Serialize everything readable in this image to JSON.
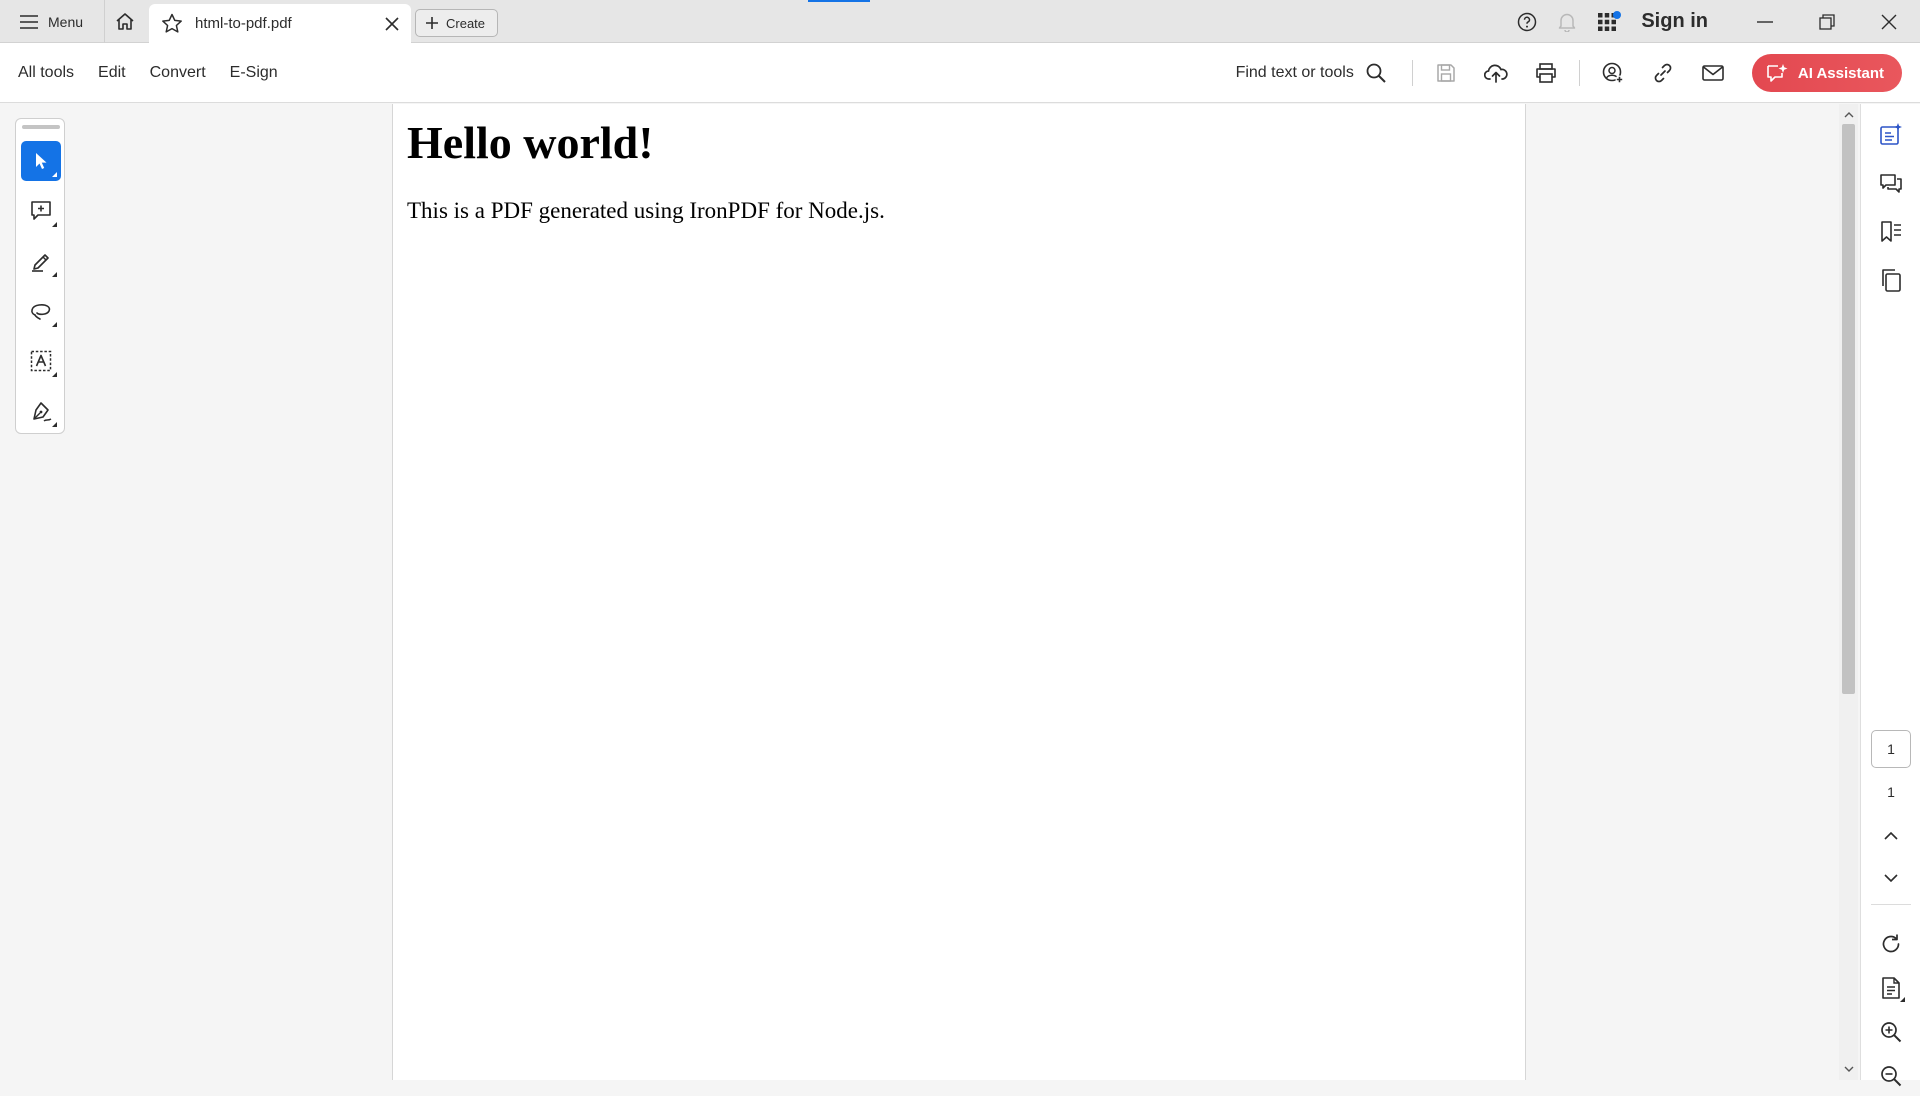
{
  "titlebar": {
    "menu_label": "Menu",
    "tab_title": "html-to-pdf.pdf",
    "create_label": "Create",
    "sign_in_label": "Sign in"
  },
  "toolbar": {
    "menu_items": [
      "All tools",
      "Edit",
      "Convert",
      "E-Sign"
    ],
    "find_label": "Find text or tools",
    "ai_assistant_label": "AI Assistant"
  },
  "document": {
    "heading": "Hello world!",
    "paragraph": "This is a PDF generated using IronPDF for Node.js."
  },
  "navigation": {
    "current_page": "1",
    "total_pages": "1"
  },
  "colors": {
    "accent": "#1473e6",
    "ai_button": "#e34850"
  }
}
